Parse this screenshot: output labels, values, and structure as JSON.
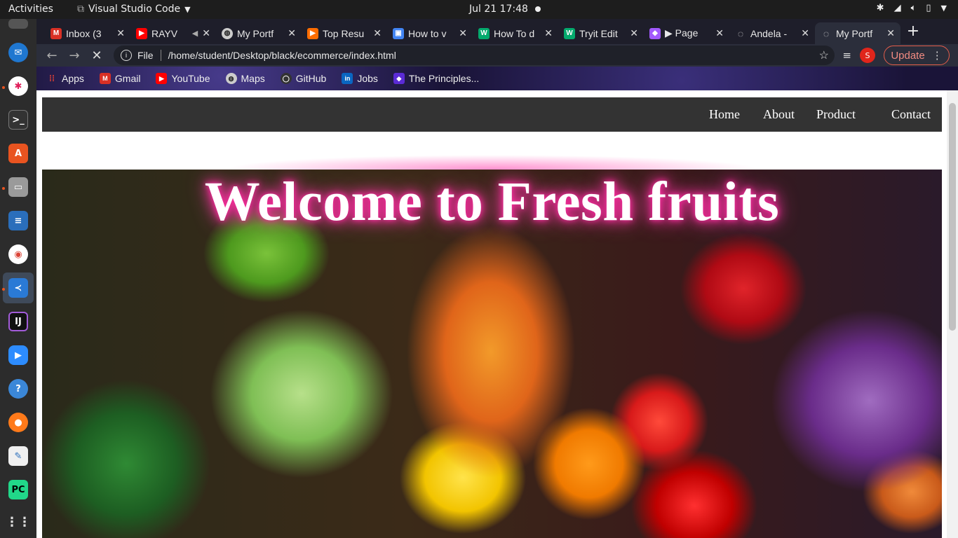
{
  "os": {
    "activities": "Activities",
    "app_name": "Visual Studio Code",
    "clock": "Jul 21  17:48"
  },
  "browser": {
    "tabs": [
      {
        "title": "Inbox (3",
        "icon": "gmail-icon",
        "color": "#d93025"
      },
      {
        "title": "RAYV",
        "icon": "youtube-icon",
        "color": "#ff0000"
      },
      {
        "title": "My Portf",
        "icon": "globe-icon",
        "color": "#cccccc"
      },
      {
        "title": "Top Resu",
        "icon": "play-icon",
        "color": "#ff6d00"
      },
      {
        "title": "How to v",
        "icon": "docs-icon",
        "color": "#4285f4"
      },
      {
        "title": "How To d",
        "icon": "w3schools-icon",
        "color": "#04aa6d"
      },
      {
        "title": "Tryit Edit",
        "icon": "w3schools-icon",
        "color": "#04aa6d"
      },
      {
        "title": "▶ Page",
        "icon": "figma-icon",
        "color": "#a259ff"
      },
      {
        "title": "Andela -",
        "icon": "loading-icon",
        "color": "#cccccc"
      },
      {
        "title": "My Portf",
        "icon": "loading-icon",
        "color": "#cccccc"
      }
    ],
    "address": {
      "scheme": "File",
      "url": "/home/student/Desktop/black/ecommerce/index.html"
    },
    "profile_initial": "S",
    "update_label": "Update",
    "bookmarks": [
      {
        "label": "Apps",
        "icon": "apps-grid-icon",
        "color": "#ea4335"
      },
      {
        "label": "Gmail",
        "icon": "gmail-icon",
        "color": "#d93025"
      },
      {
        "label": "YouTube",
        "icon": "youtube-icon",
        "color": "#ff0000"
      },
      {
        "label": "Maps",
        "icon": "globe-icon",
        "color": "#cccccc"
      },
      {
        "label": "GitHub",
        "icon": "github-icon",
        "color": "#333333"
      },
      {
        "label": "Jobs",
        "icon": "linkedin-icon",
        "color": "#0a66c2"
      },
      {
        "label": "The Principles...",
        "icon": "bookmark-icon",
        "color": "#5b2bd6"
      }
    ]
  },
  "page": {
    "nav": {
      "home": "Home",
      "about": "About",
      "product": "Product",
      "contact": "Contact"
    },
    "hero_title": "Welcome to Fresh fruits"
  }
}
